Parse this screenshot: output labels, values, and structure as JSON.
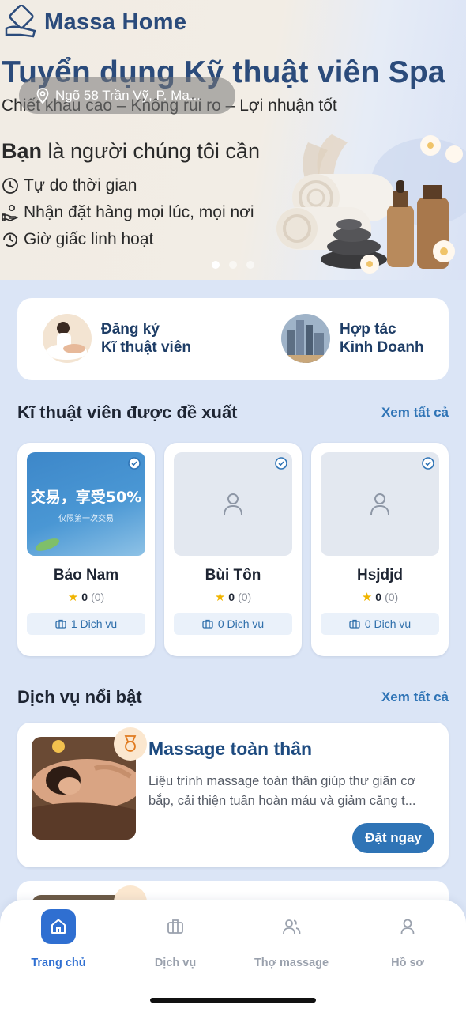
{
  "app": {
    "brand": "Massa Home"
  },
  "location": {
    "text": "Ngõ 58 Trần Vỹ, P. Ma..."
  },
  "banner": {
    "title": "Tuyển dụng Kỹ thuật viên Spa",
    "subtitle": "Chiết khấu cao – Không rủi ro – Lợi nhuận tốt",
    "heading_bold": "Bạn",
    "heading_rest": " là người chúng tôi cần",
    "features": [
      "Tự do thời gian",
      "Nhận đặt hàng mọi lúc, mọi nơi",
      "Giờ giấc linh hoạt"
    ],
    "slide_count": 3,
    "active_slide": 1
  },
  "join": {
    "register": {
      "line1": "Đăng ký",
      "line2": "Kĩ thuật viên"
    },
    "partner": {
      "line1": "Hợp tác",
      "line2": "Kinh Doanh"
    }
  },
  "recommended": {
    "title": "Kĩ thuật viên được đề xuất",
    "see_all": "Xem tất cả",
    "ad": {
      "main": "交易，享受50%",
      "sub": "仅限第一次交易"
    },
    "therapists": [
      {
        "name": "Bảo Nam",
        "rating": "0",
        "reviews": "(0)",
        "services": "1 Dịch vụ"
      },
      {
        "name": "Bùi Tôn",
        "rating": "0",
        "reviews": "(0)",
        "services": "0 Dịch vụ"
      },
      {
        "name": "Hsjdjd",
        "rating": "0",
        "reviews": "(0)",
        "services": "0 Dịch vụ"
      }
    ]
  },
  "featured": {
    "title": "Dịch vụ nổi bật",
    "see_all": "Xem tất cả",
    "services": [
      {
        "name": "Massage toàn thân",
        "description": "Liệu trình massage toàn thân giúp thư giãn cơ bắp, cải thiện tuần hoàn máu và giảm căng t...",
        "book_label": "Đặt ngay"
      }
    ]
  },
  "nav": {
    "items": [
      {
        "label": "Trang chủ",
        "icon": "home-icon",
        "active": true
      },
      {
        "label": "Dịch vụ",
        "icon": "briefcase-icon",
        "active": false
      },
      {
        "label": "Thợ massage",
        "icon": "users-icon",
        "active": false
      },
      {
        "label": "Hồ sơ",
        "icon": "user-icon",
        "active": false
      }
    ]
  },
  "colors": {
    "primary": "#2f74b6",
    "nav_active": "#2f6fd1",
    "brand": "#2b4b7b",
    "background": "#dbe5f6"
  }
}
